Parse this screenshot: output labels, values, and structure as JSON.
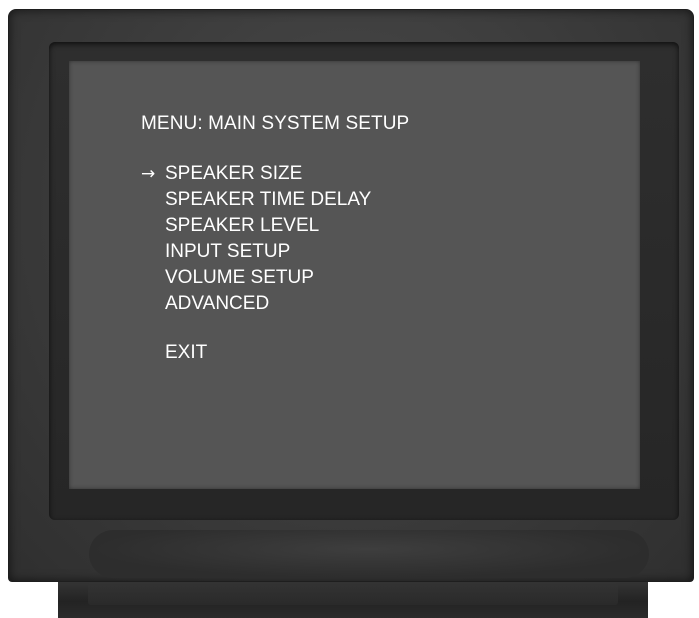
{
  "osd": {
    "title": "MENU: MAIN SYSTEM SETUP",
    "cursor": "→",
    "selected_index": 0,
    "items": [
      {
        "label": "SPEAKER SIZE"
      },
      {
        "label": "SPEAKER TIME DELAY"
      },
      {
        "label": "SPEAKER LEVEL"
      },
      {
        "label": "INPUT SETUP"
      },
      {
        "label": "VOLUME SETUP"
      },
      {
        "label": "ADVANCED"
      }
    ],
    "exit_label": "EXIT"
  },
  "colors": {
    "screen_bg": "#555555",
    "text": "#ffffff",
    "tv_body": "#3b3b3b"
  }
}
